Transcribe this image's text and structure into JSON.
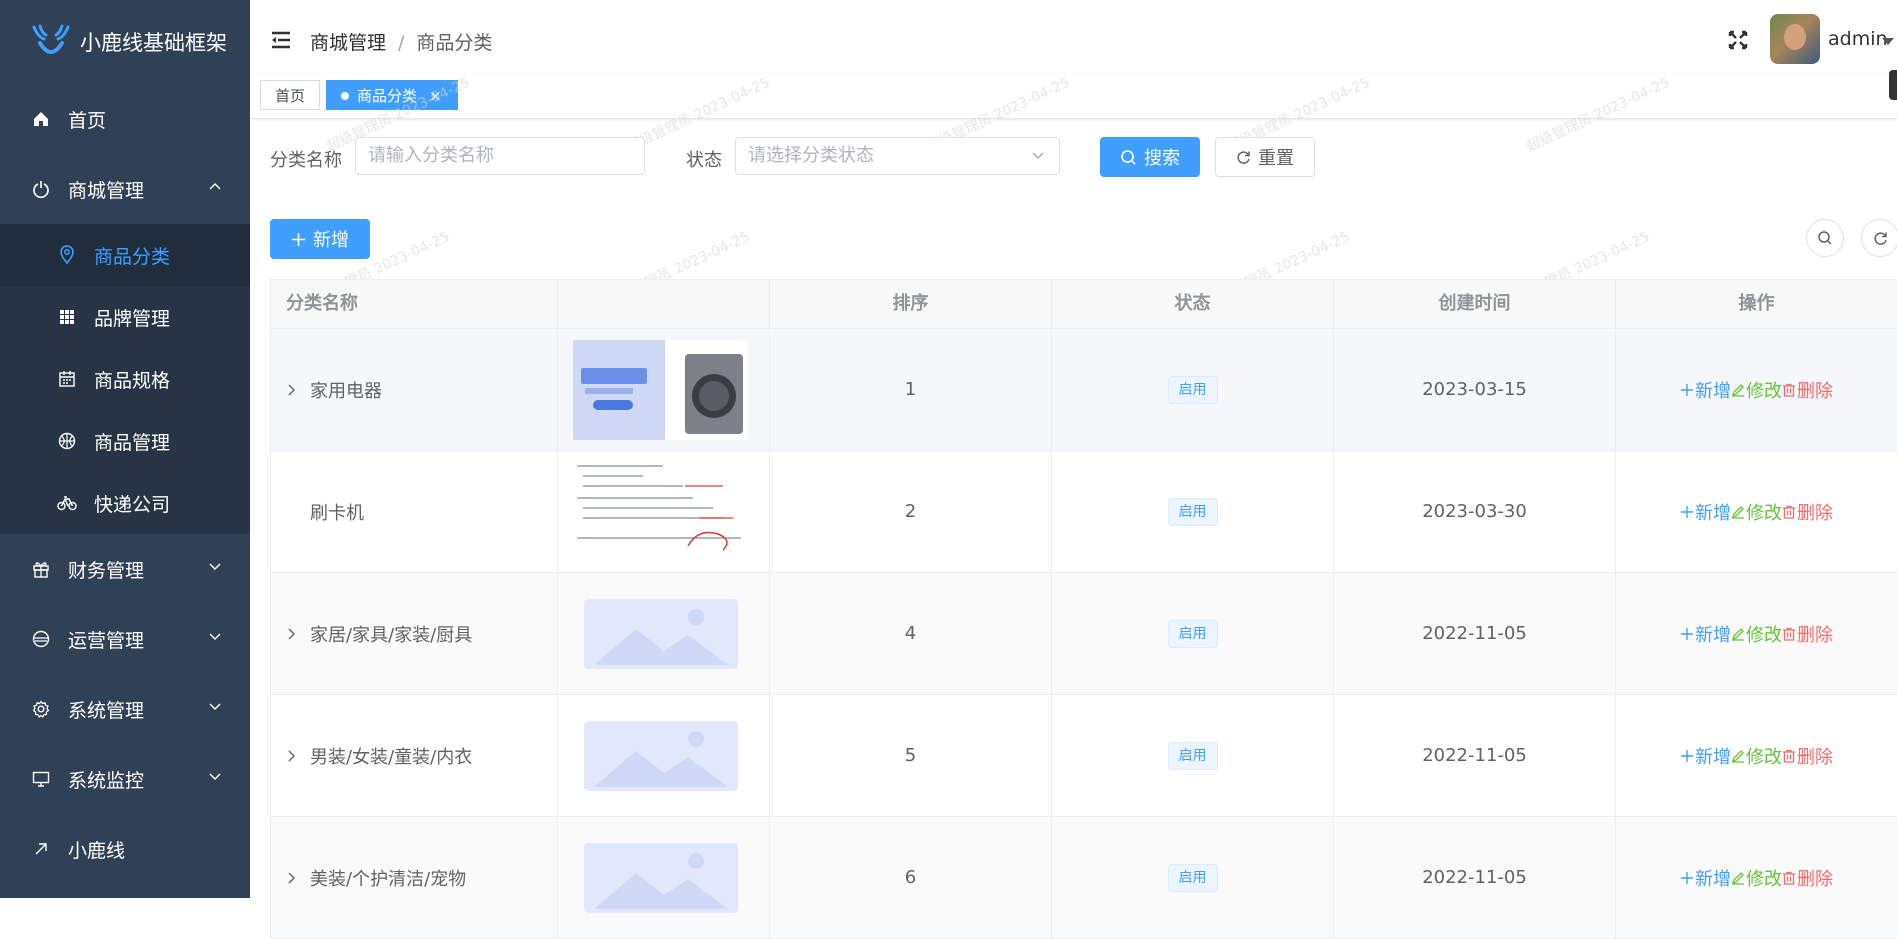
{
  "app": {
    "title": "小鹿线基础框架"
  },
  "sidebar": {
    "items": [
      {
        "label": "首页",
        "icon": "home-icon"
      },
      {
        "label": "商城管理",
        "icon": "power-icon",
        "expanded": true,
        "children": [
          {
            "label": "商品分类",
            "icon": "location-icon",
            "active": true
          },
          {
            "label": "品牌管理",
            "icon": "grid-icon"
          },
          {
            "label": "商品规格",
            "icon": "calendar-icon"
          },
          {
            "label": "商品管理",
            "icon": "basketball-icon"
          },
          {
            "label": "快递公司",
            "icon": "bicycle-icon"
          }
        ]
      },
      {
        "label": "财务管理",
        "icon": "gift-icon"
      },
      {
        "label": "运营管理",
        "icon": "disk-icon"
      },
      {
        "label": "系统管理",
        "icon": "gear-icon"
      },
      {
        "label": "系统监控",
        "icon": "monitor-icon"
      },
      {
        "label": "小鹿线",
        "icon": "arrow-up-right-icon"
      }
    ]
  },
  "header": {
    "breadcrumb": [
      "商城管理",
      "商品分类"
    ],
    "user": "admin"
  },
  "tags": {
    "home": "首页",
    "active": "商品分类",
    "close": "×"
  },
  "search": {
    "name_label": "分类名称",
    "name_placeholder": "请输入分类名称",
    "status_label": "状态",
    "status_placeholder": "请选择分类状态",
    "search_button": "搜索",
    "reset_button": "重置"
  },
  "toolbar": {
    "add_button": "新增"
  },
  "table": {
    "columns": [
      "分类名称",
      "",
      "排序",
      "状态",
      "创建时间",
      "操作"
    ],
    "actions": {
      "add": "新增",
      "edit": "修改",
      "delete": "删除"
    },
    "rows": [
      {
        "name": "家用电器",
        "sort": "1",
        "status": "启用",
        "created": "2023-03-15",
        "image": "appliance-banner",
        "expandable": true
      },
      {
        "name": "刷卡机",
        "sort": "2",
        "status": "启用",
        "created": "2023-03-30",
        "image": "document-screenshot",
        "expandable": false
      },
      {
        "name": "家居/家具/家装/厨具",
        "sort": "4",
        "status": "启用",
        "created": "2022-11-05",
        "image": "placeholder",
        "expandable": true
      },
      {
        "name": "男装/女装/童装/内衣",
        "sort": "5",
        "status": "启用",
        "created": "2022-11-05",
        "image": "placeholder",
        "expandable": true
      },
      {
        "name": "美装/个护清洁/宠物",
        "sort": "6",
        "status": "启用",
        "created": "2022-11-05",
        "image": "placeholder",
        "expandable": true
      }
    ]
  },
  "watermark": {
    "text": "超级管理员",
    "date": "2023-04-25"
  },
  "colors": {
    "sidebar": "#304156",
    "submenu": "#263445",
    "accent": "#409eff",
    "success": "#67c23a",
    "danger": "#f56c6c"
  }
}
